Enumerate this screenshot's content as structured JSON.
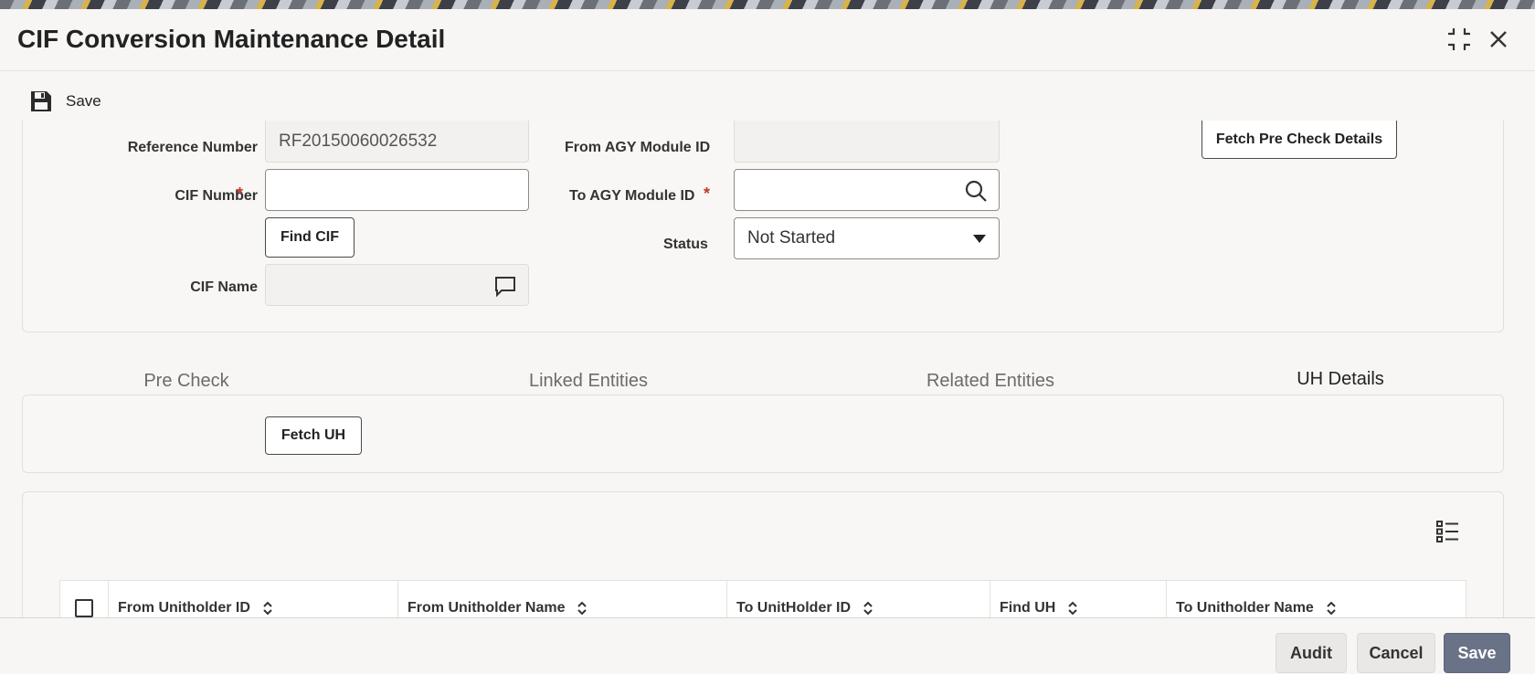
{
  "window": {
    "title": "CIF Conversion Maintenance Detail",
    "maximize_icon": "compress-icon",
    "close_icon": "close-icon"
  },
  "toolbar": {
    "save_label": "Save",
    "save_icon": "floppy-disk-icon"
  },
  "form": {
    "reference_number": {
      "label": "Reference Number",
      "value": "RF20150060026532"
    },
    "cif_number": {
      "label": "CIF Number",
      "required_mark": "*",
      "value": ""
    },
    "find_cif_label": "Find CIF",
    "cif_name": {
      "label": "CIF Name",
      "value": "",
      "icon": "comment-icon"
    },
    "from_agy_module_id": {
      "label": "From AGY Module ID",
      "value": ""
    },
    "to_agy_module_id": {
      "label": "To AGY Module ID",
      "required_mark": "*",
      "value": "",
      "icon": "search-icon"
    },
    "status": {
      "label": "Status",
      "value": "Not Started"
    },
    "fetch_pre_check_label": "Fetch Pre Check Details"
  },
  "tabs": [
    {
      "label": "Pre Check",
      "active": false
    },
    {
      "label": "Linked Entities",
      "active": false
    },
    {
      "label": "Related Entities",
      "active": false
    },
    {
      "label": "UH Details",
      "active": true
    }
  ],
  "uh_details": {
    "fetch_uh_label": "Fetch UH",
    "columns_icon": "column-list-icon",
    "columns": [
      "From Unitholder ID",
      "From Unitholder Name",
      "To UnitHolder ID",
      "Find UH",
      "To Unitholder Name"
    ]
  },
  "footer": {
    "audit_label": "Audit",
    "cancel_label": "Cancel",
    "save_label": "Save"
  },
  "colors": {
    "primary_button": "#6a7288",
    "active_tab_underline": "#6a6f82",
    "required": "#c0392b"
  }
}
